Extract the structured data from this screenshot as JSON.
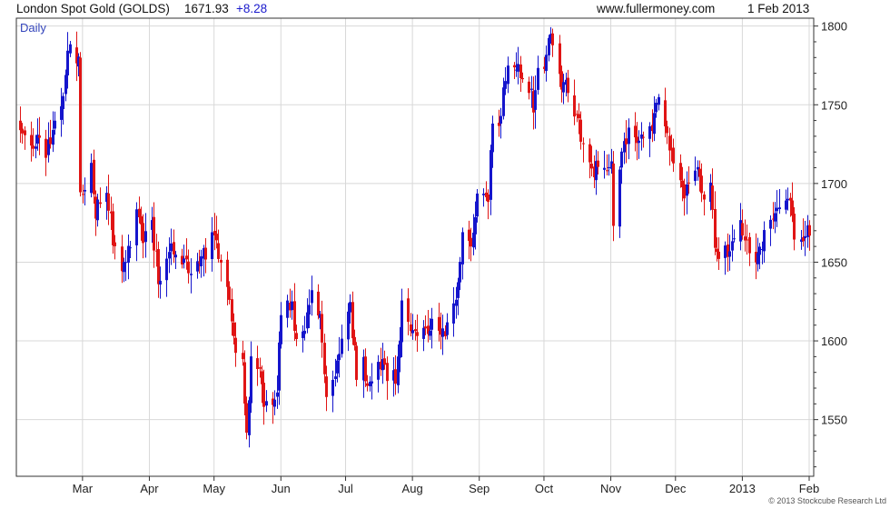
{
  "header": {
    "title": "London Spot Gold (GOLDS)",
    "last": "1671.93",
    "change": "+8.28",
    "site": "www.fullermoney.com",
    "date": "1 Feb 2013"
  },
  "chart_data": {
    "type": "candlestick",
    "period_label": "Daily",
    "x_tick_labels": [
      "Mar",
      "Apr",
      "May",
      "Jun",
      "Jul",
      "Aug",
      "Sep",
      "Oct",
      "Nov",
      "Dec",
      "2013",
      "Feb"
    ],
    "y_ticks": [
      1550,
      1600,
      1650,
      1700,
      1750,
      1800
    ],
    "ylim": [
      1514,
      1805
    ],
    "grid": true,
    "copyright": "© 2013 Stockcube Research Ltd",
    "colors": {
      "up": "#1515cc",
      "down": "#e01515",
      "grid": "#d8d8d8",
      "border": "#333333"
    },
    "close_path": [
      [
        "2012-02-01",
        1737
      ],
      [
        "2012-02-03",
        1725
      ],
      [
        "2012-02-08",
        1728
      ],
      [
        "2012-02-13",
        1720
      ],
      [
        "2012-02-17",
        1735
      ],
      [
        "2012-02-21",
        1760
      ],
      [
        "2012-02-23",
        1785
      ],
      [
        "2012-02-28",
        1780
      ],
      [
        "2012-02-29",
        1695
      ],
      [
        "2012-03-05",
        1708
      ],
      [
        "2012-03-07",
        1680
      ],
      [
        "2012-03-12",
        1700
      ],
      [
        "2012-03-15",
        1665
      ],
      [
        "2012-03-19",
        1648
      ],
      [
        "2012-03-22",
        1655
      ],
      [
        "2012-03-26",
        1680
      ],
      [
        "2012-03-29",
        1663
      ],
      [
        "2012-04-02",
        1674
      ],
      [
        "2012-04-05",
        1640
      ],
      [
        "2012-04-10",
        1658
      ],
      [
        "2012-04-16",
        1650
      ],
      [
        "2012-04-20",
        1643
      ],
      [
        "2012-04-24",
        1650
      ],
      [
        "2012-04-30",
        1665
      ],
      [
        "2012-05-03",
        1655
      ],
      [
        "2012-05-07",
        1640
      ],
      [
        "2012-05-10",
        1600
      ],
      [
        "2012-05-14",
        1585
      ],
      [
        "2012-05-16",
        1545
      ],
      [
        "2012-05-18",
        1590
      ],
      [
        "2012-05-21",
        1585
      ],
      [
        "2012-05-24",
        1560
      ],
      [
        "2012-05-30",
        1565
      ],
      [
        "2012-06-01",
        1622
      ],
      [
        "2012-06-04",
        1620
      ],
      [
        "2012-06-06",
        1620
      ],
      [
        "2012-06-08",
        1597
      ],
      [
        "2012-06-12",
        1612
      ],
      [
        "2012-06-15",
        1627
      ],
      [
        "2012-06-19",
        1620
      ],
      [
        "2012-06-22",
        1567
      ],
      [
        "2012-06-26",
        1580
      ],
      [
        "2012-06-29",
        1600
      ],
      [
        "2012-07-03",
        1620
      ],
      [
        "2012-07-06",
        1580
      ],
      [
        "2012-07-09",
        1585
      ],
      [
        "2012-07-12",
        1570
      ],
      [
        "2012-07-16",
        1585
      ],
      [
        "2012-07-20",
        1580
      ],
      [
        "2012-07-24",
        1575
      ],
      [
        "2012-07-27",
        1620
      ],
      [
        "2012-08-01",
        1610
      ],
      [
        "2012-08-06",
        1605
      ],
      [
        "2012-08-10",
        1614
      ],
      [
        "2012-08-15",
        1606
      ],
      [
        "2012-08-20",
        1620
      ],
      [
        "2012-08-22",
        1640
      ],
      [
        "2012-08-24",
        1670
      ],
      [
        "2012-08-28",
        1660
      ],
      [
        "2012-08-31",
        1690
      ],
      [
        "2012-09-05",
        1693
      ],
      [
        "2012-09-07",
        1738
      ],
      [
        "2012-09-10",
        1732
      ],
      [
        "2012-09-13",
        1770
      ],
      [
        "2012-09-17",
        1770
      ],
      [
        "2012-09-21",
        1772
      ],
      [
        "2012-09-26",
        1750
      ],
      [
        "2012-09-28",
        1775
      ],
      [
        "2012-10-01",
        1778
      ],
      [
        "2012-10-04",
        1792
      ],
      [
        "2012-10-09",
        1765
      ],
      [
        "2012-10-12",
        1758
      ],
      [
        "2012-10-16",
        1745
      ],
      [
        "2012-10-19",
        1725
      ],
      [
        "2012-10-23",
        1710
      ],
      [
        "2012-10-26",
        1708
      ],
      [
        "2012-11-01",
        1715
      ],
      [
        "2012-11-02",
        1675
      ],
      [
        "2012-11-06",
        1715
      ],
      [
        "2012-11-09",
        1735
      ],
      [
        "2012-11-14",
        1728
      ],
      [
        "2012-11-19",
        1733
      ],
      [
        "2012-11-23",
        1750
      ],
      [
        "2012-11-28",
        1725
      ],
      [
        "2012-11-30",
        1714
      ],
      [
        "2012-12-05",
        1695
      ],
      [
        "2012-12-07",
        1700
      ],
      [
        "2012-12-11",
        1710
      ],
      [
        "2012-12-13",
        1695
      ],
      [
        "2012-12-17",
        1695
      ],
      [
        "2012-12-19",
        1665
      ],
      [
        "2012-12-21",
        1655
      ],
      [
        "2012-12-27",
        1660
      ],
      [
        "2012-12-31",
        1675
      ],
      [
        "2013-01-03",
        1665
      ],
      [
        "2013-01-07",
        1650
      ],
      [
        "2013-01-10",
        1663
      ],
      [
        "2013-01-15",
        1680
      ],
      [
        "2013-01-18",
        1686
      ],
      [
        "2013-01-23",
        1688
      ],
      [
        "2013-01-25",
        1660
      ],
      [
        "2013-01-29",
        1664
      ],
      [
        "2013-01-31",
        1672
      ]
    ]
  }
}
